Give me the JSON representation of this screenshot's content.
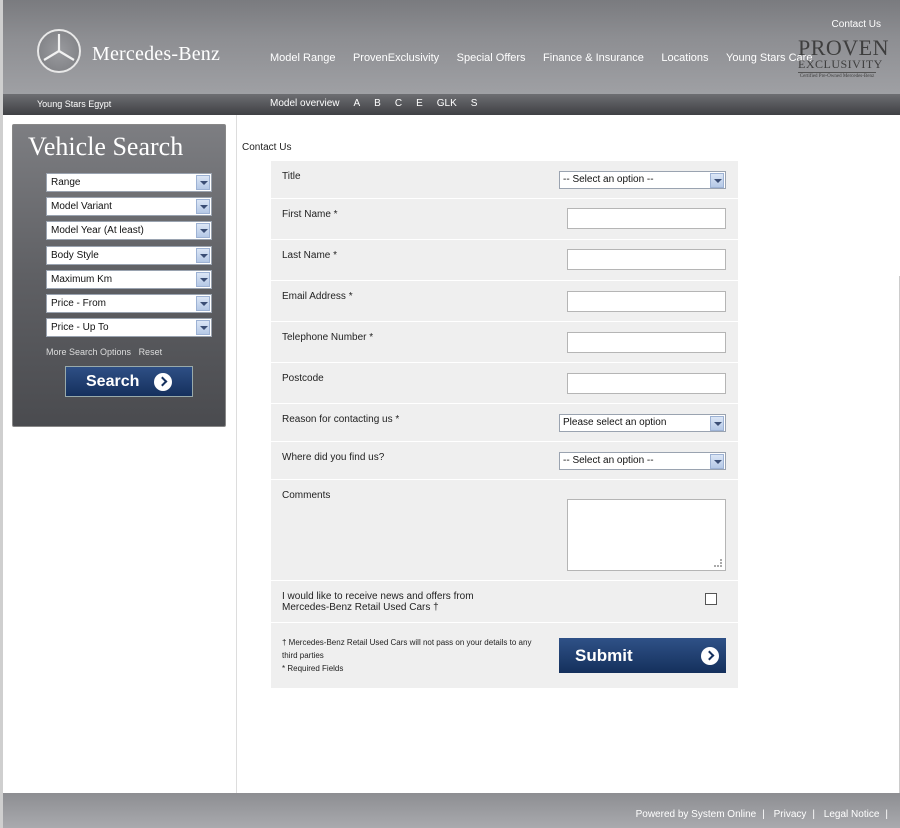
{
  "header": {
    "brand": "Mercedes-Benz",
    "contact_link": "Contact Us",
    "nav": [
      "Model Range",
      "ProvenExclusivity",
      "Special Offers",
      "Finance & Insurance",
      "Locations",
      "Young Stars Care"
    ],
    "proven_logo": {
      "line1": "PROVEN",
      "line2": "EXCLUSIVITY",
      "line3": "Certified Pre-Owned Mercedes-Benz"
    }
  },
  "subbar": {
    "site_name": "Young Stars Egypt",
    "nav": [
      "Model overview",
      "A",
      "B",
      "C",
      "E",
      "GLK",
      "S"
    ]
  },
  "vehicle_search": {
    "title": "Vehicle Search",
    "selects": [
      "Range",
      "Model Variant",
      "Model Year (At least)",
      "Body Style",
      "Maximum Km",
      "Price - From",
      "Price - Up To"
    ],
    "more_options": "More Search Options",
    "reset": "Reset",
    "search_button": "Search"
  },
  "page": {
    "title": "Contact Us"
  },
  "form": {
    "title_label": "Title",
    "title_value": "-- Select an option --",
    "first_name_label": "First Name *",
    "last_name_label": "Last Name *",
    "email_label": "Email Address *",
    "phone_label": "Telephone Number *",
    "postcode_label": "Postcode",
    "reason_label": "Reason for contacting us *",
    "reason_value": "Please select an option",
    "source_label": "Where did you find us?",
    "source_value": "-- Select an option --",
    "comments_label": "Comments",
    "optin_line1": "I would like to receive news and offers from",
    "optin_line2": "Mercedes-Benz Retail Used Cars †",
    "note_line1": "† Mercedes-Benz Retail Used Cars will not pass on your details to any",
    "note_line2": "third parties",
    "note_line3": "* Required Fields",
    "submit_label": "Submit"
  },
  "footer": {
    "powered": "Powered by System Online",
    "privacy": "Privacy",
    "legal": "Legal Notice"
  },
  "colors": {
    "header_gray": "#8d8e92",
    "button_blue": "#1e3d6e",
    "form_bg": "#efefef"
  }
}
